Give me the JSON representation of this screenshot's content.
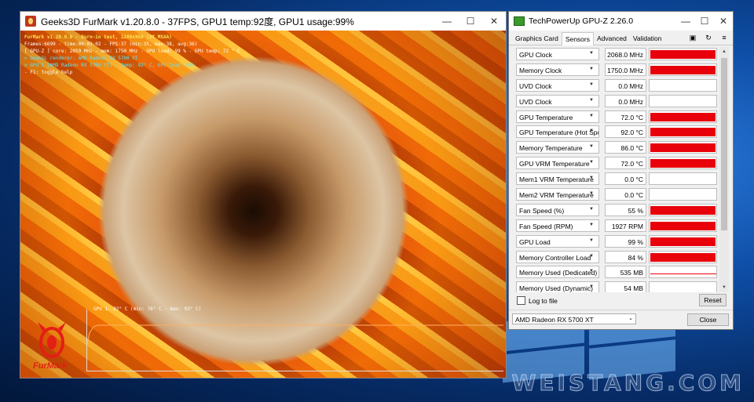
{
  "furmark": {
    "title": "Geeks3D FurMark v1.20.8.0 - 37FPS, GPU1 temp:92度, GPU1 usage:99%",
    "osd": [
      {
        "text": "FurMark v1.20.8.0 - Burn-in test, 1280x968 (8X MSAA)",
        "color": "y"
      },
      {
        "text": "Frames:6699 - time:00:03:02 - FPS:37 (min:35, max:38, avg:36)",
        "color": "w"
      },
      {
        "text": "[ GPU-Z ] core: 2059 MHz - mem: 1750 MHz - GPU load: 99 % - GPU temp: 72 ° C",
        "color": "w"
      },
      {
        "text": "> OpenGL renderer: AMD Radeon RX 5700 XT",
        "color": "c"
      },
      {
        "text": "> GPU 1 (AMD Radeon RX 5700 XT) - temp: 92° C, GPU load: 99%",
        "color": "c"
      },
      {
        "text": "- F1: toggle help",
        "color": "w"
      }
    ],
    "graph_label": "GPU 1: 92° C (min: 76° C - max: 93° C)",
    "logo_text": "FurMark"
  },
  "gpuz": {
    "title": "TechPowerUp GPU-Z 2.26.0",
    "tabs": [
      {
        "label": "Graphics Card",
        "active": false
      },
      {
        "label": "Sensors",
        "active": true
      },
      {
        "label": "Advanced",
        "active": false
      },
      {
        "label": "Validation",
        "active": false
      }
    ],
    "sensors": [
      {
        "name": "GPU Clock",
        "value": "2068.0 MHz",
        "level": 0.99
      },
      {
        "name": "Memory Clock",
        "value": "1750.0 MHz",
        "level": 0.99
      },
      {
        "name": "UVD Clock",
        "value": "0.0 MHz",
        "level": 0
      },
      {
        "name": "UVD Clock",
        "value": "0.0 MHz",
        "level": 0
      },
      {
        "name": "GPU Temperature",
        "value": "72.0 °C",
        "level": 0.99
      },
      {
        "name": "GPU Temperature (Hot Spot)",
        "value": "92.0 °C",
        "level": 0.99
      },
      {
        "name": "Memory Temperature",
        "value": "86.0 °C",
        "level": 0.99
      },
      {
        "name": "GPU VRM Temperature",
        "value": "72.0 °C",
        "level": 0.99
      },
      {
        "name": "Mem1 VRM Temperature",
        "value": "0.0 °C",
        "level": 0
      },
      {
        "name": "Mem2 VRM Temperature",
        "value": "0.0 °C",
        "level": 0
      },
      {
        "name": "Fan Speed (%)",
        "value": "55 %",
        "level": 0.99
      },
      {
        "name": "Fan Speed (RPM)",
        "value": "1927 RPM",
        "level": 0.99
      },
      {
        "name": "GPU Load",
        "value": "99 %",
        "level": 0.99
      },
      {
        "name": "Memory Controller Load",
        "value": "84 %",
        "level": 0.99
      },
      {
        "name": "Memory Used (Dedicated)",
        "value": "535 MB",
        "level": 0.06
      },
      {
        "name": "Memory Used (Dynamic)",
        "value": "54 MB",
        "level": 0
      }
    ],
    "log_to_file_label": "Log to file",
    "reset_label": "Reset",
    "gpu_select": "AMD Radeon RX 5700 XT",
    "close_label": "Close"
  },
  "watermark": "WEISTANG.COM",
  "colors": {
    "bar_fill": "#e8000a"
  }
}
